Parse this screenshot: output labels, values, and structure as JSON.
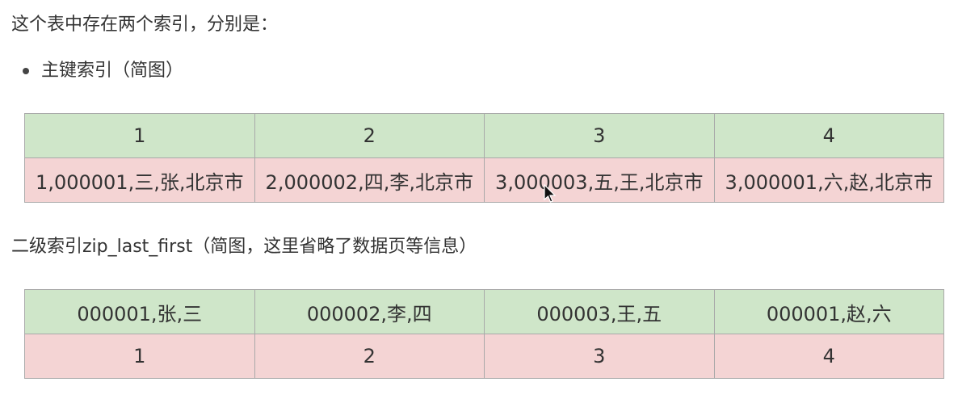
{
  "intro_text": "这个表中存在两个索引，分别是：",
  "primary": {
    "bullet_label": "主键索引（简图）",
    "header_row": [
      "1",
      "2",
      "3",
      "4"
    ],
    "data_row": [
      "1,000001,三,张,北京市",
      "2,000002,四,李,北京市",
      "3,000003,五,王,北京市",
      "3,000001,六,赵,北京市"
    ]
  },
  "secondary": {
    "heading": "二级索引zip_last_first（简图，这里省略了数据页等信息）",
    "header_row": [
      "000001,张,三",
      "000002,李,四",
      "000003,王,五",
      "000001,赵,六"
    ],
    "pointer_row": [
      "1",
      "2",
      "3",
      "4"
    ]
  },
  "colors": {
    "header_green": "#cfe6c9",
    "data_pink": "#f4d4d4",
    "border": "#a9a9a9"
  }
}
